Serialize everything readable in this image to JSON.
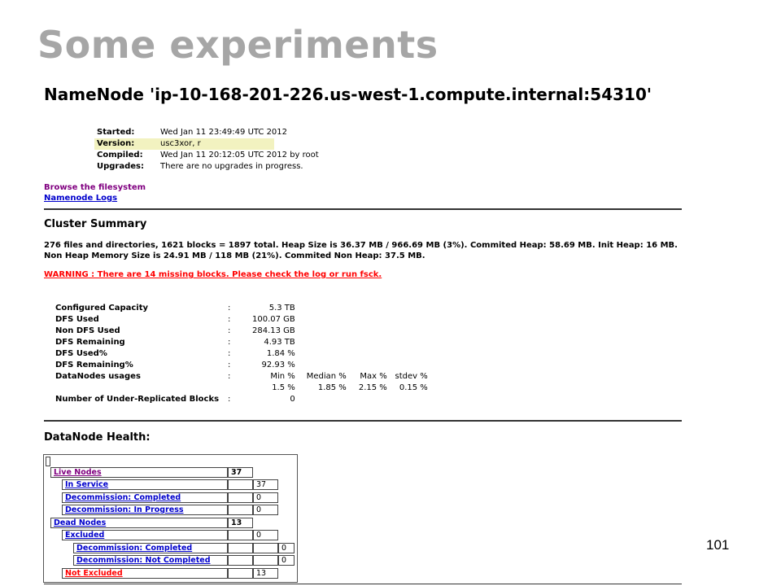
{
  "slide": {
    "title": "Some experiments",
    "page_number": "101"
  },
  "namenode": {
    "title": "NameNode 'ip-10-168-201-226.us-west-1.compute.internal:54310'",
    "info": [
      {
        "key": "Started:",
        "value": "Wed Jan 11 23:49:49 UTC 2012"
      },
      {
        "key": "Version:",
        "value": "usc3xor, r"
      },
      {
        "key": "Compiled:",
        "value": "Wed Jan 11 20:12:05 UTC 2012 by root"
      },
      {
        "key": "Upgrades:",
        "value": "There are no upgrades in progress."
      }
    ],
    "links": {
      "browse": "Browse the filesystem",
      "logs": "Namenode Logs"
    }
  },
  "cluster_summary": {
    "heading": "Cluster Summary",
    "line1": "276 files and directories, 1621 blocks = 1897 total. Heap Size is 36.37 MB / 966.69 MB (3%). Commited Heap: 58.69 MB. Init Heap: 16 MB.",
    "line2": "Non Heap Memory Size is 24.91 MB / 118 MB (21%). Commited Non Heap: 37.5 MB.",
    "warning": "WARNING : There are 14 missing blocks. Please check the log or run fsck.",
    "colon": ":",
    "stats": [
      {
        "key": "Configured Capacity",
        "value": "5.3 TB"
      },
      {
        "key": "DFS Used",
        "value": "100.07 GB"
      },
      {
        "key": "Non DFS Used",
        "value": "284.13 GB"
      },
      {
        "key": "DFS Remaining",
        "value": "4.93 TB"
      },
      {
        "key": "DFS Used%",
        "value": "1.84 %"
      },
      {
        "key": "DFS Remaining%",
        "value": "92.93 %"
      }
    ],
    "usages": {
      "key": "DataNodes usages",
      "headers": [
        "Min %",
        "Median %",
        "Max %",
        "stdev %"
      ],
      "values": [
        "1.5 %",
        "1.85 %",
        "2.15 %",
        "0.15 %"
      ]
    },
    "under_replicated": {
      "key": "Number of Under-Replicated Blocks",
      "value": "0"
    }
  },
  "datanode_health": {
    "heading": "DataNode Health:",
    "rows": {
      "live_nodes": {
        "label": "Live Nodes",
        "value": "37"
      },
      "in_service": {
        "label": "In Service",
        "value": "37"
      },
      "decom_completed": {
        "label": "Decommission: Completed",
        "value": "0"
      },
      "decom_in_progress": {
        "label": "Decommission: In Progress",
        "value": "0"
      },
      "dead_nodes": {
        "label": "Dead Nodes",
        "value": "13"
      },
      "excluded": {
        "label": "Excluded",
        "value": "0"
      },
      "excl_decom_completed": {
        "label": "Decommission: Completed",
        "value": "0"
      },
      "excl_decom_not_completed": {
        "label": "Decommission: Not Completed",
        "value": "0"
      },
      "not_excluded": {
        "label": "Not Excluded",
        "value": "13"
      }
    }
  }
}
